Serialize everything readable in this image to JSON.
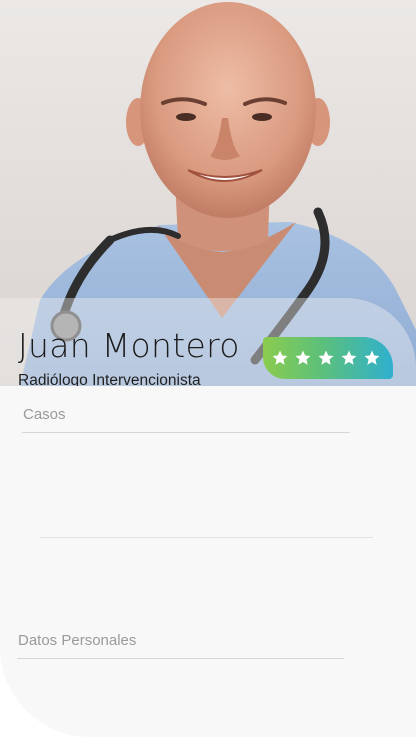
{
  "profile": {
    "name": "Juan Montero",
    "specialty": "Radiólogo Intervencionista",
    "rating": 5,
    "rating_max": 5,
    "photo_icon": "doctor-portrait"
  },
  "sections": {
    "cases_label": "Casos",
    "personal_data_label": "Datos Personales"
  },
  "colors": {
    "rating_gradient_start": "#8bcc4e",
    "rating_gradient_end": "#2fb0cf",
    "card_background": "#f8f8f8",
    "label_color": "#9a9a9a"
  }
}
